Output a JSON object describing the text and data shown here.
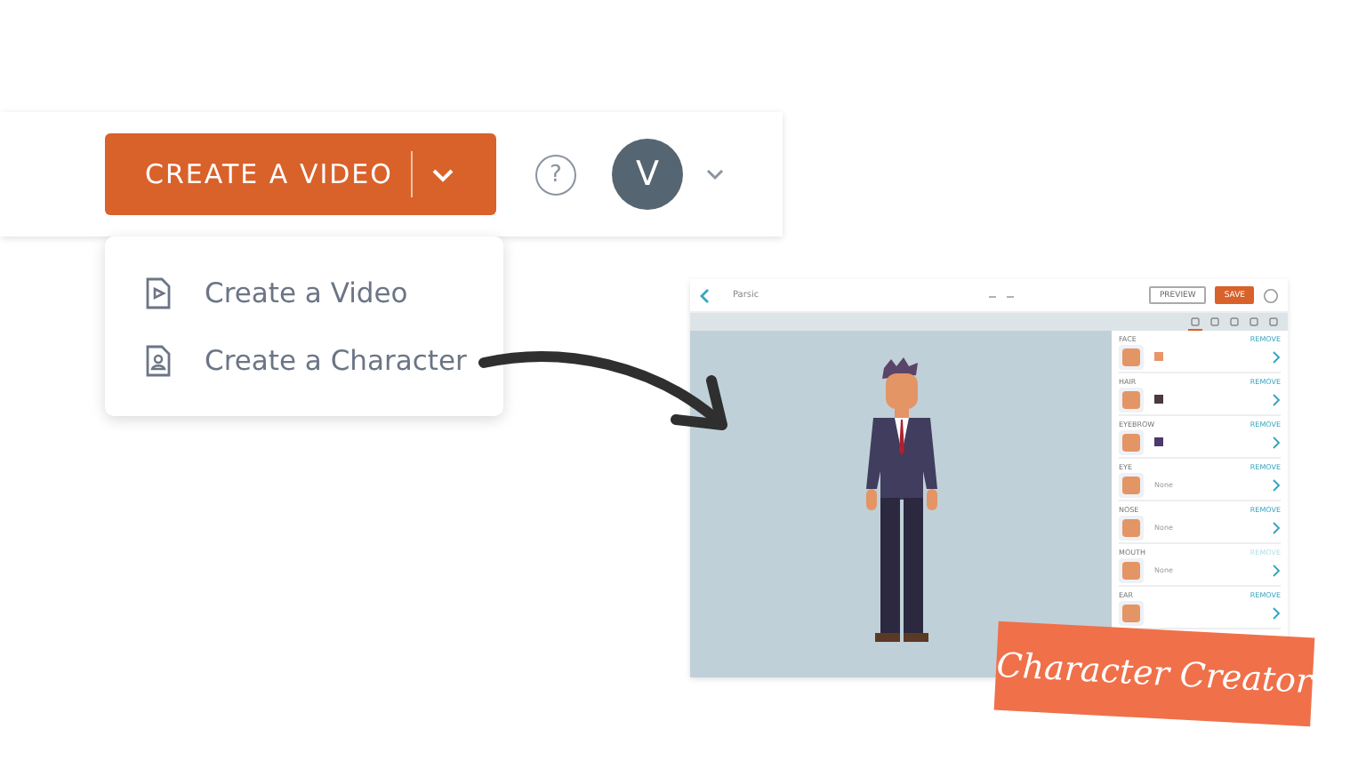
{
  "topbar": {
    "create_button": "CREATE A VIDEO",
    "help": "?",
    "avatar": "V"
  },
  "dropdown": [
    {
      "label": "Create a Video",
      "kind": "video"
    },
    {
      "label": "Create a Character",
      "kind": "character"
    }
  ],
  "editor": {
    "title": "Parsic",
    "buttons": [
      {
        "label": "PREVIEW",
        "kind": "outline"
      },
      {
        "label": "SAVE",
        "kind": "primary"
      }
    ],
    "tabs": [
      {
        "selected": true
      },
      {
        "selected": false
      },
      {
        "selected": false
      },
      {
        "selected": false
      },
      {
        "selected": false
      }
    ],
    "traits": [
      {
        "label": "FACE",
        "action": "REMOVE",
        "disabled": false,
        "color": "#e8956a"
      },
      {
        "label": "HAIR",
        "action": "REMOVE",
        "disabled": false,
        "color": "#4a3a40"
      },
      {
        "label": "EYEBROW",
        "action": "REMOVE",
        "disabled": false,
        "color": "#4b3a6b"
      },
      {
        "label": "EYE",
        "action": "REMOVE",
        "disabled": false,
        "value": "None"
      },
      {
        "label": "NOSE",
        "action": "REMOVE",
        "disabled": false,
        "value": "None"
      },
      {
        "label": "MOUTH",
        "action": "REMOVE",
        "disabled": true,
        "value": "None"
      },
      {
        "label": "EAR",
        "action": "REMOVE",
        "disabled": false
      }
    ]
  },
  "badge": "Character Creator"
}
